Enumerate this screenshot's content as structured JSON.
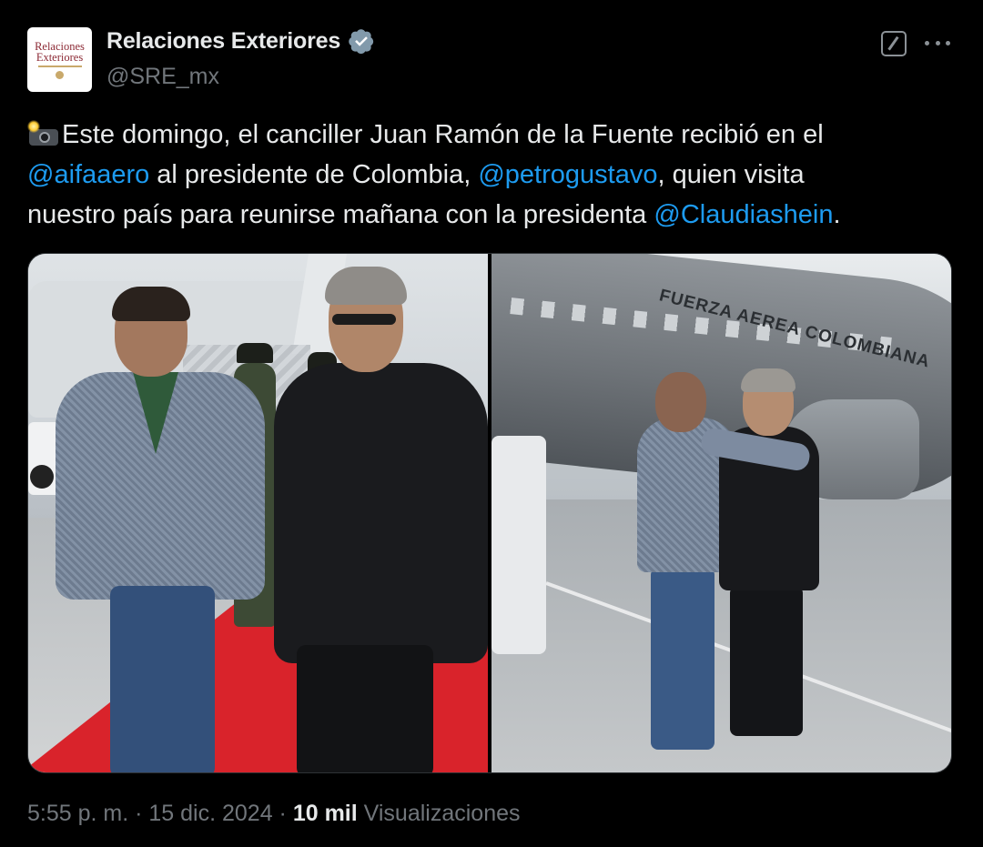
{
  "account": {
    "display_name": "Relaciones Exteriores",
    "handle": "@SRE_mx",
    "avatar_line1": "Relaciones",
    "avatar_line2": "Exteriores",
    "verified_icon": "verified-badge-icon"
  },
  "actions": {
    "grok_icon": "grok-icon",
    "more_icon": "more-options-icon"
  },
  "tweet": {
    "emoji": "camera-with-flash-emoji",
    "text_part1": "Este domingo, el canciller Juan Ramón de la Fuente recibió en el",
    "mention1": "@aifaaero",
    "text_part2": " al presidente de Colombia, ",
    "mention2": "@petrogustavo",
    "text_part3": ", quien visita",
    "text_part4": "nuestro país para reunirse mañana con la presidenta ",
    "mention3": "@Claudiashein",
    "text_part5": "."
  },
  "media": {
    "count": 2,
    "photo2_fuselage_text": "FUERZA AEREA COLOMBIANA"
  },
  "meta": {
    "time": "5:55 p. m.",
    "separator1": " · ",
    "date": "15 dic. 2024",
    "separator2": " · ",
    "views_count": "10 mil",
    "views_label": " Visualizaciones"
  },
  "colors": {
    "background": "#000000",
    "text": "#e7e9ea",
    "secondary": "#71767b",
    "link": "#1d9bf0",
    "verified": "#829aab"
  }
}
